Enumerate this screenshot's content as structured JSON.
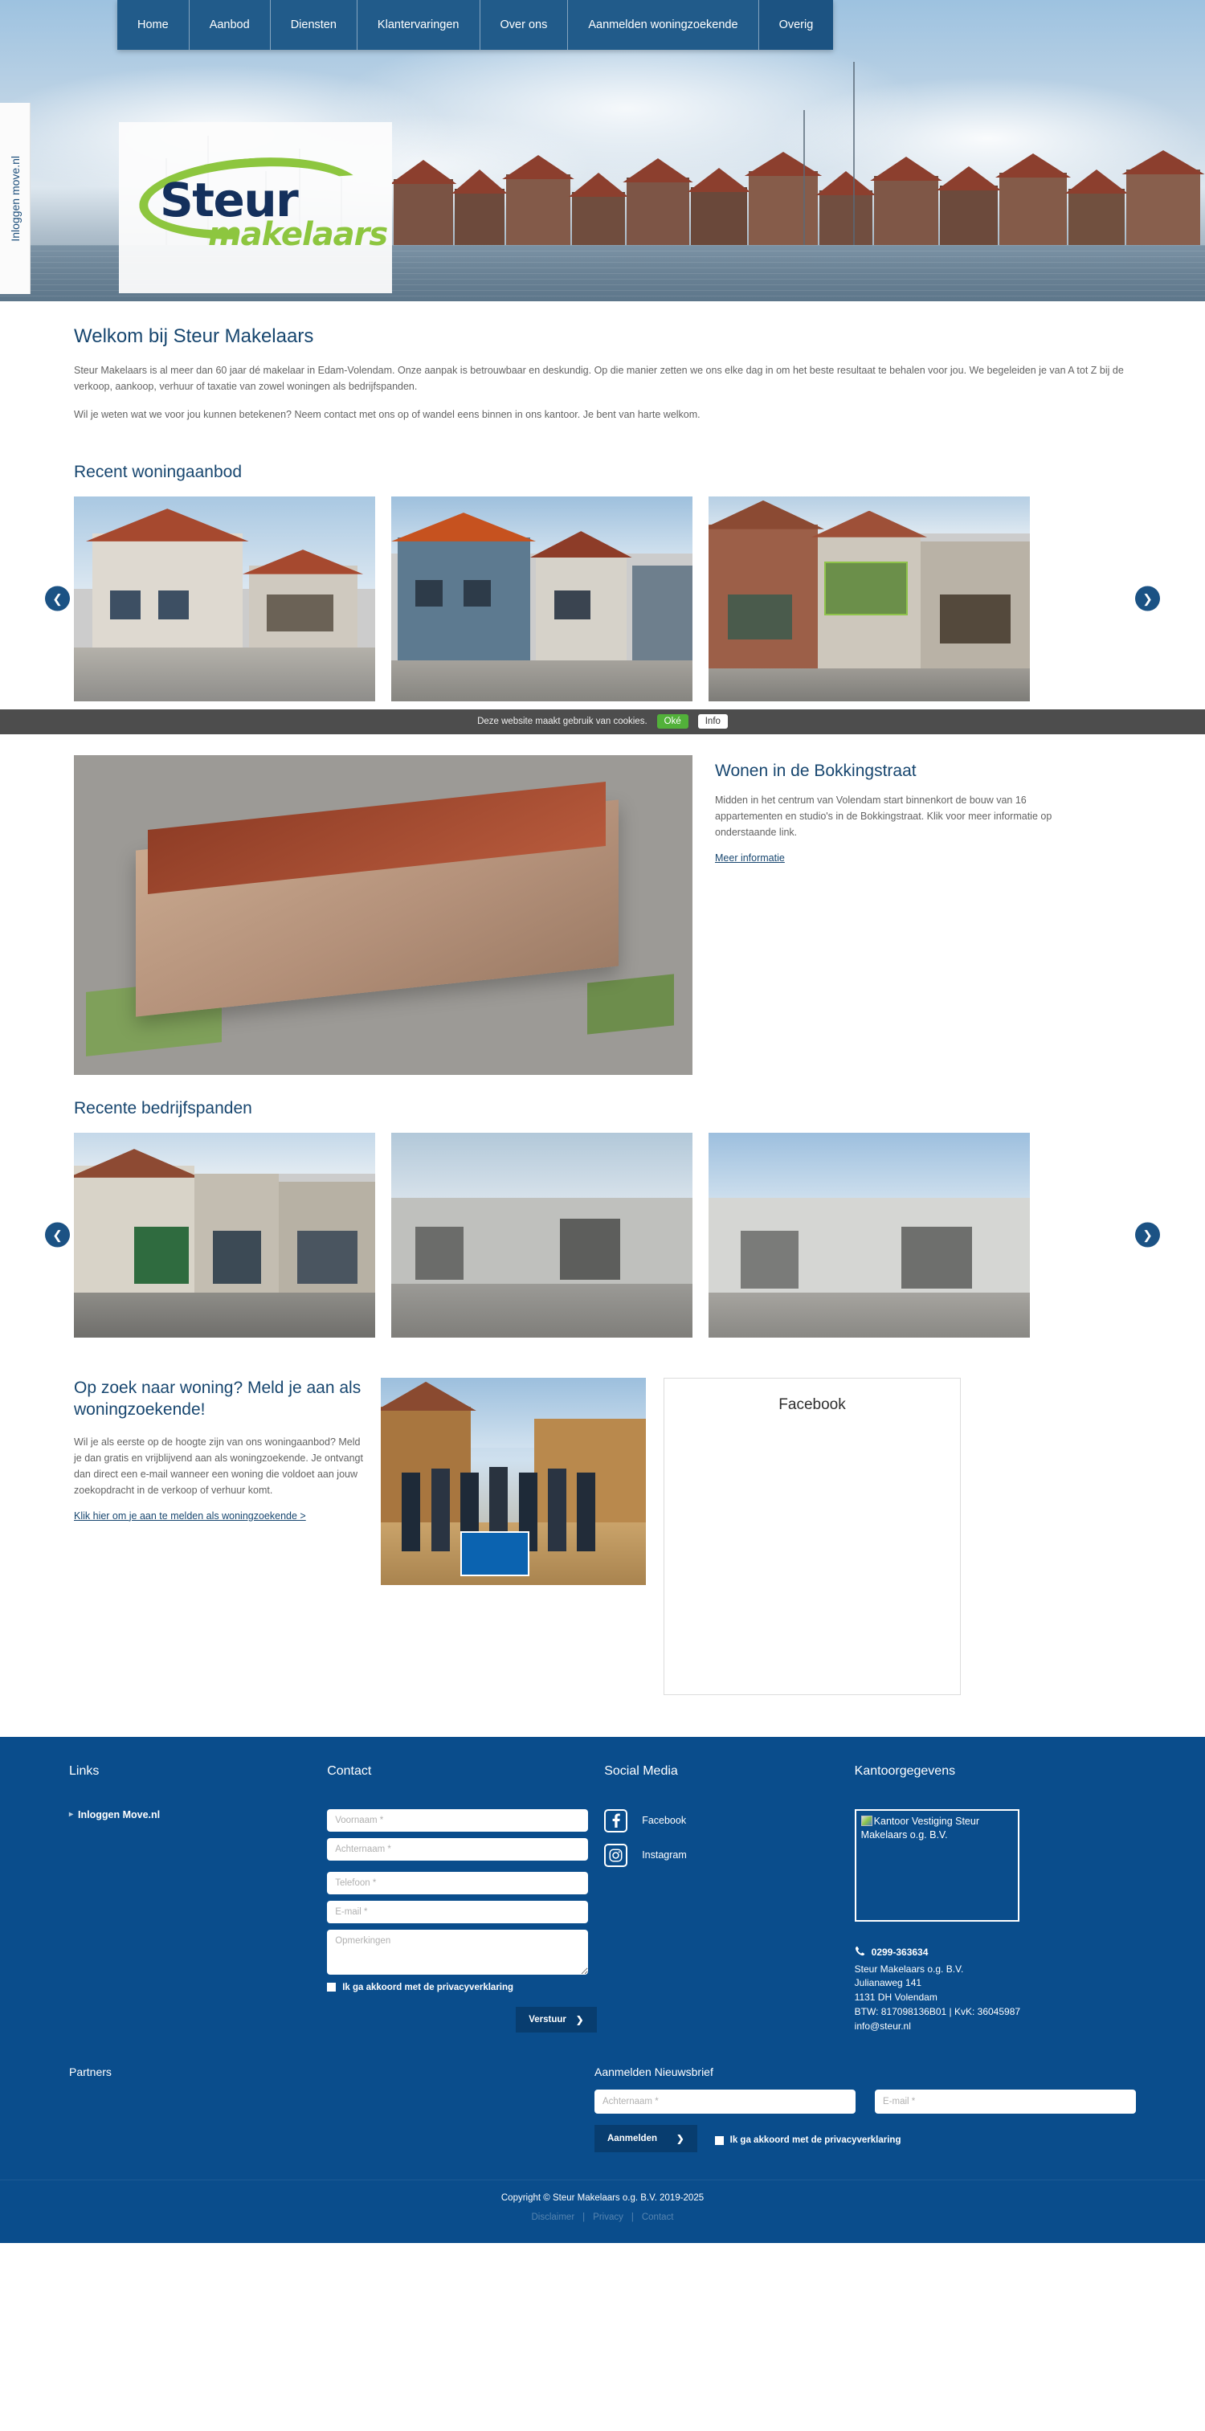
{
  "nav": {
    "items": [
      {
        "label": "Home",
        "active": false
      },
      {
        "label": "Aanbod",
        "active": false
      },
      {
        "label": "Diensten",
        "active": false
      },
      {
        "label": "Klantervaringen",
        "active": false
      },
      {
        "label": "Over ons",
        "active": false
      },
      {
        "label": "Aanmelden woningzoekende",
        "active": false
      },
      {
        "label": "Overig",
        "active": true
      }
    ]
  },
  "login_tab": {
    "label": "Inloggen move.nl"
  },
  "logo": {
    "primary": "Steur",
    "secondary": "makelaars",
    "primary_color": "#14305c",
    "accent_color": "#8dc63f"
  },
  "welcome": {
    "title": "Welkom bij Steur Makelaars",
    "paragraph1": "Steur Makelaars is al meer dan 60 jaar dé makelaar in Edam-Volendam. Onze aanpak is betrouwbaar en deskundig. Op die manier zetten we ons elke dag in om het beste resultaat te behalen voor jou. We begeleiden je van A tot Z bij de verkoop, aankoop, verhuur of taxatie van zowel woningen als bedrijfspanden.",
    "paragraph2": "Wil je weten wat we voor jou kunnen betekenen? Neem contact met ons op of wandel eens binnen in ons kantoor. Je bent van harte welkom."
  },
  "housing": {
    "heading": "Recent woningaanbod",
    "prev_icon": "chevron-left-icon",
    "next_icon": "chevron-right-icon"
  },
  "cookie": {
    "message": "Deze website maakt gebruik van cookies.",
    "accept_label": "Oké",
    "info_label": "Info",
    "accept_color": "#52b13a"
  },
  "feature": {
    "title": "Wonen in de Bokkingstraat",
    "text": "Midden in het centrum van Volendam start binnenkort de bouw van 16 appartementen en studio's in de Bokkingstraat. Klik voor meer informatie op onderstaande link.",
    "link_label": "Meer informatie"
  },
  "commercial": {
    "heading": "Recente bedrijfspanden",
    "prev_icon": "chevron-left-icon",
    "next_icon": "chevron-right-icon"
  },
  "seeker": {
    "title": "Op zoek naar woning? Meld je aan als woningzoekende!",
    "text": "Wil je als eerste op de hoogte zijn van ons woningaanbod? Meld je dan gratis en vrijblijvend aan als woningzoekende. Je ontvangt dan direct een e-mail wanneer een woning die voldoet aan jouw zoekopdracht in de verkoop of verhuur komt.",
    "link_label": "Klik hier om je aan te melden als woningzoekende >"
  },
  "facebook_widget": {
    "title": "Facebook"
  },
  "footer": {
    "links": {
      "heading": "Links",
      "items": [
        {
          "label": "Inloggen Move.nl"
        }
      ]
    },
    "contact": {
      "heading": "Contact",
      "fields": [
        {
          "name": "voornaam",
          "placeholder": "Voornaam *",
          "value": ""
        },
        {
          "name": "achternaam",
          "placeholder": "Achternaam *",
          "value": ""
        },
        {
          "name": "telefoon",
          "placeholder": "Telefoon *",
          "value": ""
        },
        {
          "name": "email",
          "placeholder": "E-mail *",
          "value": ""
        }
      ],
      "textarea_placeholder": "Opmerkingen",
      "consent_label": "Ik ga akkoord met de privacyverklaring",
      "submit_label": "Verstuur",
      "submit_icon": "chevron-right-icon"
    },
    "social": {
      "heading": "Social Media",
      "items": [
        {
          "label": "Facebook",
          "icon": "facebook-icon"
        },
        {
          "label": "Instagram",
          "icon": "instagram-icon"
        }
      ]
    },
    "office": {
      "heading": "Kantoorgegevens",
      "image_alt": "Kantoor Vestiging Steur Makelaars o.g. B.V.",
      "phone": "0299-363634",
      "phone_icon": "phone-icon",
      "company": "Steur Makelaars o.g. B.V.",
      "street": "Julianaweg 141",
      "city": "1131 DH Volendam",
      "tax": "BTW: 817098136B01 | KvK: 36045987",
      "email": "info@steur.nl"
    },
    "partners": {
      "heading": "Partners"
    },
    "newsletter": {
      "heading": "Aanmelden Nieuwsbrief",
      "lastname_placeholder": "Achternaam *",
      "email_placeholder": "E-mail *",
      "submit_label": "Aanmelden",
      "submit_icon": "chevron-right-icon",
      "consent_label": "Ik ga akkoord met de privacyverklaring"
    },
    "copyright": "Copyright © Steur Makelaars o.g. B.V. 2019-2025",
    "bottom_links": [
      "Disclaimer",
      "Privacy",
      "Contact"
    ],
    "bottom_separator": "|",
    "background_color": "#0a4d8c"
  }
}
